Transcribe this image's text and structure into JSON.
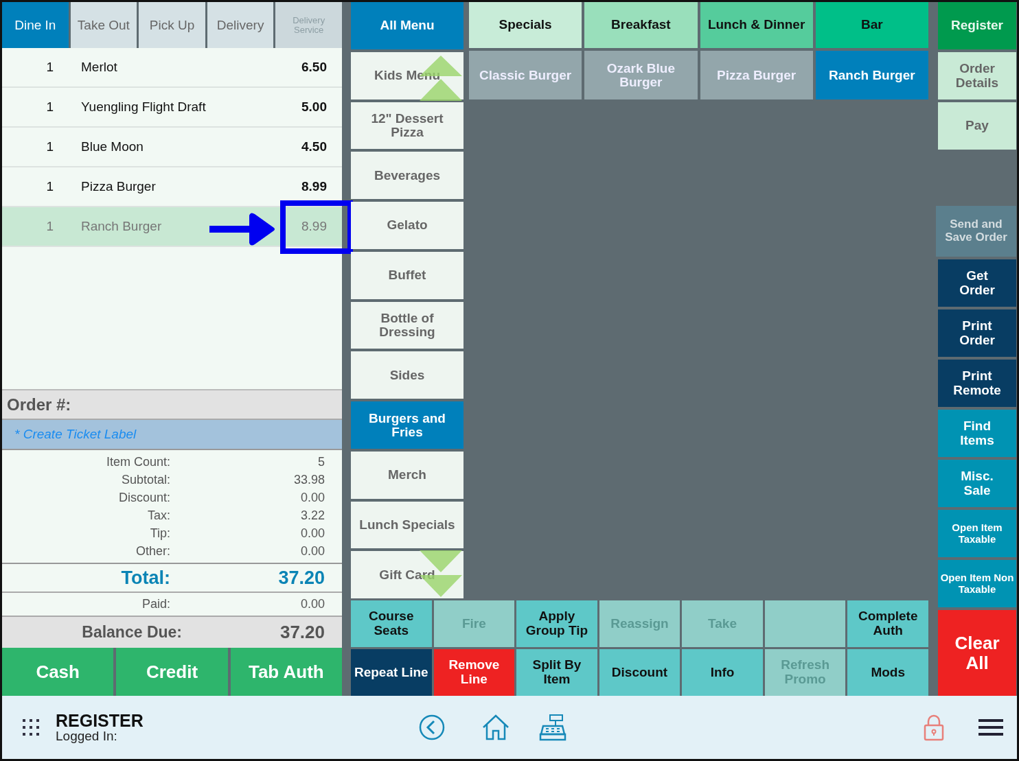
{
  "order_tabs": [
    {
      "label": "Dine In",
      "selected": true,
      "disabled": false
    },
    {
      "label": "Take Out",
      "selected": false,
      "disabled": false
    },
    {
      "label": "Pick Up",
      "selected": false,
      "disabled": false
    },
    {
      "label": "Delivery",
      "selected": false,
      "disabled": false
    },
    {
      "label": "Delivery Service",
      "selected": false,
      "disabled": true
    }
  ],
  "order_lines": [
    {
      "qty": "1",
      "name": "Merlot",
      "price": "6.50",
      "selected": false,
      "highlighted": false
    },
    {
      "qty": "1",
      "name": "Yuengling Flight Draft",
      "price": "5.00",
      "selected": false,
      "highlighted": false
    },
    {
      "qty": "1",
      "name": "Blue Moon",
      "price": "4.50",
      "selected": false,
      "highlighted": false
    },
    {
      "qty": "1",
      "name": "Pizza Burger",
      "price": "8.99",
      "selected": false,
      "highlighted": false
    },
    {
      "qty": "1",
      "name": "Ranch Burger",
      "price": "8.99",
      "selected": true,
      "highlighted": true
    }
  ],
  "order_number_label": "Order #:",
  "ticket_label": "* Create Ticket Label",
  "summary": [
    {
      "label": "Item Count:",
      "value": "5"
    },
    {
      "label": "Subtotal:",
      "value": "33.98"
    },
    {
      "label": "Discount:",
      "value": "0.00"
    },
    {
      "label": "Tax:",
      "value": "3.22"
    },
    {
      "label": "Tip:",
      "value": "0.00"
    },
    {
      "label": "Other:",
      "value": "0.00"
    }
  ],
  "total": {
    "label": "Total:",
    "value": "37.20"
  },
  "paid": {
    "label": "Paid:",
    "value": "0.00"
  },
  "balance_due": {
    "label": "Balance Due:",
    "value": "37.20"
  },
  "payment_buttons": [
    "Cash",
    "Credit",
    "Tab Auth"
  ],
  "categories": [
    {
      "label": "All Menu",
      "selected": true
    },
    {
      "label": "Kids Menu",
      "selected": false
    },
    {
      "label": "12\" Dessert Pizza",
      "selected": false
    },
    {
      "label": "Beverages",
      "selected": false
    },
    {
      "label": "Gelato",
      "selected": false
    },
    {
      "label": "Buffet",
      "selected": false
    },
    {
      "label": "Bottle of Dressing",
      "selected": false
    },
    {
      "label": "Sides",
      "selected": false
    },
    {
      "label": "Burgers and Fries",
      "selected": true
    },
    {
      "label": "Merch",
      "selected": false
    },
    {
      "label": "Lunch Specials",
      "selected": false
    },
    {
      "label": "Gift Card",
      "selected": false
    }
  ],
  "menu_groups": [
    {
      "label": "Specials",
      "color": "#c8ecd8"
    },
    {
      "label": "Breakfast",
      "color": "#99dfbb"
    },
    {
      "label": "Lunch & Dinner",
      "color": "#55cc9c"
    },
    {
      "label": "Bar",
      "color": "#00bf88"
    }
  ],
  "menu_items": [
    {
      "label": "Classic Burger",
      "selected": false
    },
    {
      "label": "Ozark Blue Burger",
      "selected": false
    },
    {
      "label": "Pizza Burger",
      "selected": false
    },
    {
      "label": "Ranch Burger",
      "selected": true
    }
  ],
  "actions": [
    {
      "label": "Course Seats",
      "kind": "teal"
    },
    {
      "label": "Fire",
      "kind": "disabled"
    },
    {
      "label": "Apply Group Tip",
      "kind": "teal"
    },
    {
      "label": "Reassign",
      "kind": "disabled"
    },
    {
      "label": "Take",
      "kind": "disabled"
    },
    {
      "kind": "disabled"
    },
    {
      "label": "Complete Auth",
      "kind": "teal"
    },
    {
      "label": "Repeat Line",
      "kind": "navy"
    },
    {
      "label": "Remove Line",
      "kind": "red"
    },
    {
      "label": "Split By Item",
      "kind": "teal"
    },
    {
      "label": "Discount",
      "kind": "teal"
    },
    {
      "label": "Info",
      "kind": "teal"
    },
    {
      "label": "Refresh Promo",
      "kind": "disabled"
    },
    {
      "label": "Mods",
      "kind": "teal"
    }
  ],
  "side_top": [
    {
      "label": "Register",
      "kind": "register"
    },
    {
      "label": "Order Details",
      "kind": "light"
    },
    {
      "label": "Pay",
      "kind": "light"
    }
  ],
  "side_bottom": [
    {
      "label": "Send and Save Order",
      "kind": "muted"
    },
    {
      "label": "Get Order",
      "kind": "navy"
    },
    {
      "label": "Print Order",
      "kind": "navy"
    },
    {
      "label": "Print Remote",
      "kind": "navy"
    },
    {
      "label": "Find Items",
      "kind": "info"
    },
    {
      "label": "Misc. Sale",
      "kind": "info"
    },
    {
      "label": "Open Item Taxable",
      "kind": "info-small"
    },
    {
      "label": "Open Item Non Taxable",
      "kind": "info-small"
    },
    {
      "label": "Clear All",
      "kind": "red"
    }
  ],
  "footer": {
    "title": "REGISTER",
    "subtitle": "Logged In:"
  }
}
